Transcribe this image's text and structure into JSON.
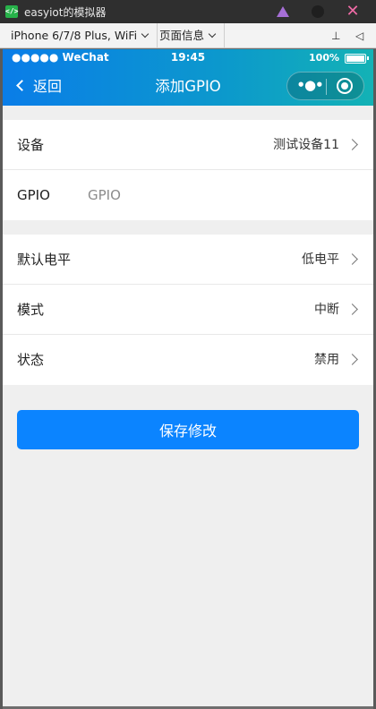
{
  "window": {
    "title": "easyiot的模拟器",
    "logo_text": "</>",
    "accent_colors": {
      "pin": "#a66fd6",
      "close": "#f06ba6"
    }
  },
  "toolbar": {
    "device_select": "iPhone 6/7/8 Plus, WiFi",
    "page_select": "页面信息",
    "pin_icon_glyph": "⊥",
    "sound_icon_glyph": "◁"
  },
  "statusbar": {
    "signal": "●●●●● WeChat",
    "time": "19:45",
    "battery": "100%"
  },
  "navbar": {
    "back_label": "返回",
    "title": "添加GPIO",
    "menu_glyph": "•●•"
  },
  "form": {
    "device": {
      "label": "设备",
      "value": "测试设备11"
    },
    "gpio": {
      "label": "GPIO",
      "placeholder": "GPIO",
      "value": ""
    },
    "level": {
      "label": "默认电平",
      "value": "低电平"
    },
    "mode": {
      "label": "模式",
      "value": "中断"
    },
    "state": {
      "label": "状态",
      "value": "禁用"
    }
  },
  "actions": {
    "save_label": "保存修改",
    "save_color": "#0b84ff"
  }
}
